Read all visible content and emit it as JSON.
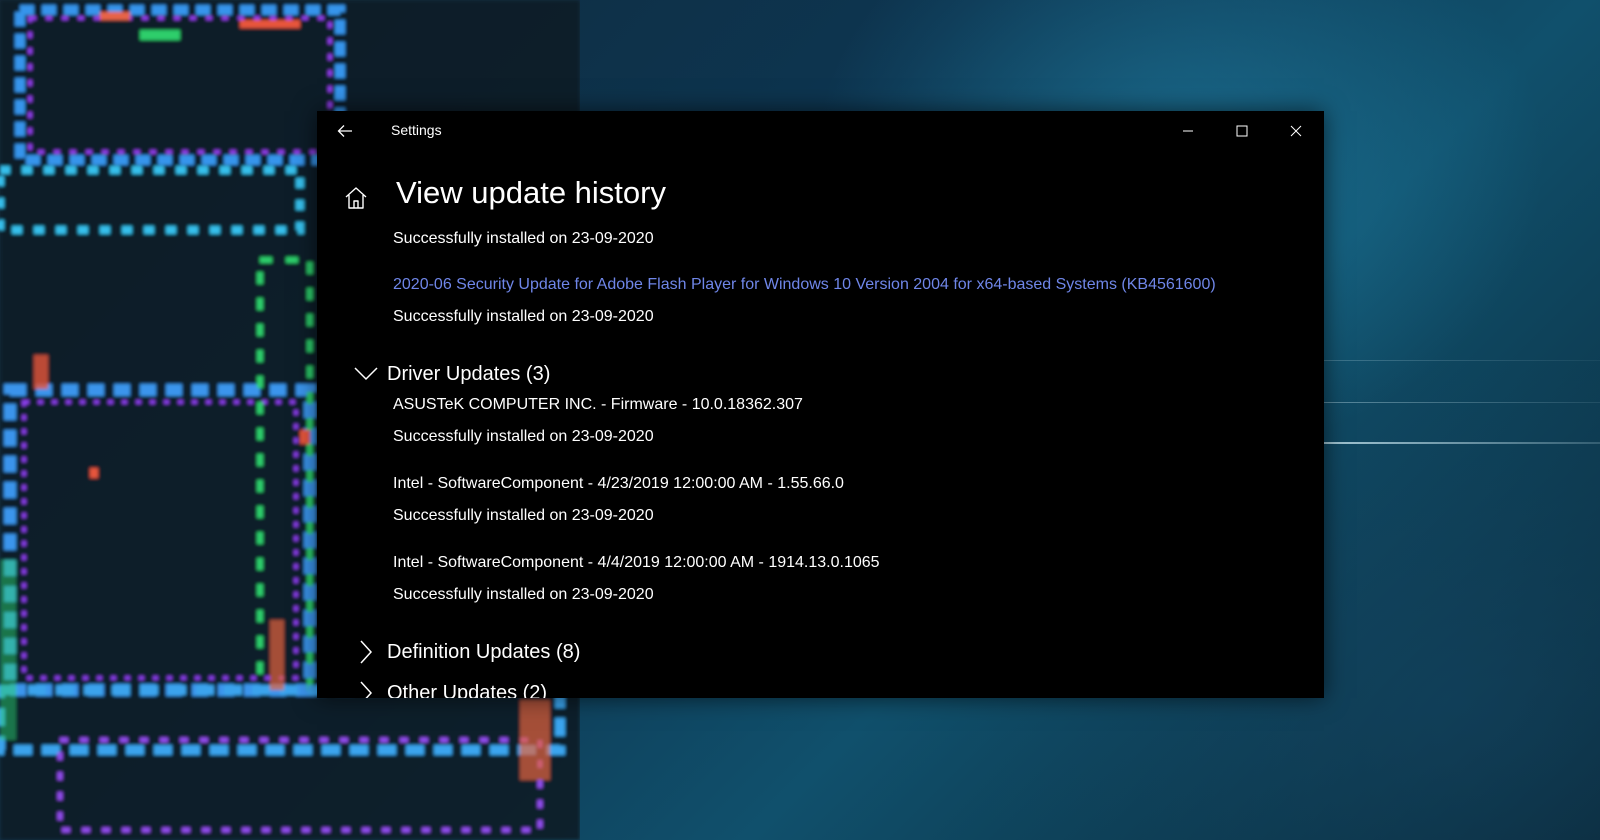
{
  "window": {
    "app_title": "Settings",
    "page_title": "View update history"
  },
  "icons": {
    "back": "back-arrow-icon",
    "home": "home-icon",
    "minimize": "minimize-icon",
    "maximize": "maximize-icon",
    "close": "close-icon",
    "expanded": "chevron-down-icon",
    "collapsed": "chevron-right-icon"
  },
  "colors": {
    "window_bg": "#000000",
    "text": "#ffffff",
    "link": "#6f86e8"
  },
  "quality_updates_tail": {
    "prev_status": "Successfully installed on 23-09-2020",
    "item": {
      "title": "2020-06 Security Update for Adobe Flash Player for Windows 10 Version 2004 for x64-based Systems (KB4561600)",
      "status": "Successfully installed on 23-09-2020"
    }
  },
  "driver_updates": {
    "label": "Driver Updates (3)",
    "expanded": true,
    "items": [
      {
        "title": "ASUSTeK COMPUTER INC. - Firmware - 10.0.18362.307",
        "status": "Successfully installed on 23-09-2020"
      },
      {
        "title": "Intel - SoftwareComponent - 4/23/2019 12:00:00 AM - 1.55.66.0",
        "status": "Successfully installed on 23-09-2020"
      },
      {
        "title": "Intel - SoftwareComponent - 4/4/2019 12:00:00 AM - 1914.13.0.1065",
        "status": "Successfully installed on 23-09-2020"
      }
    ]
  },
  "definition_updates": {
    "label": "Definition Updates (8)",
    "expanded": false
  },
  "other_updates": {
    "label": "Other Updates (2)",
    "expanded": false
  }
}
